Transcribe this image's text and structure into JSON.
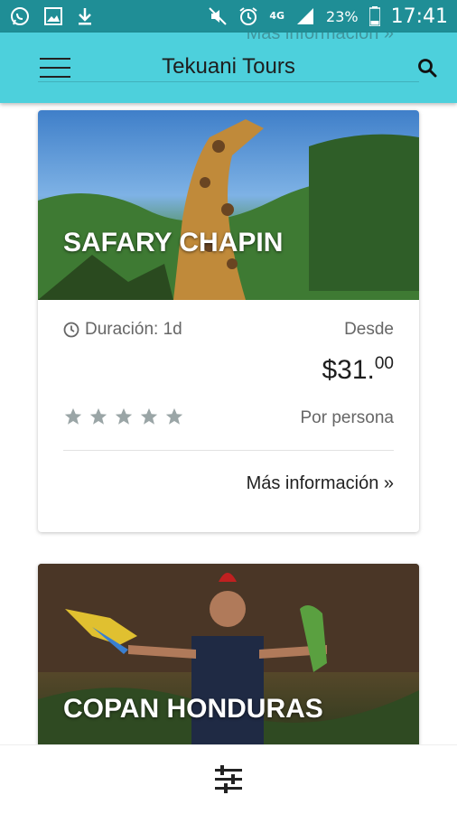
{
  "status_bar": {
    "network_label": "4G",
    "battery": "23%",
    "time": "17:41"
  },
  "app_bar": {
    "title": "Tekuani Tours",
    "ghost_link": "Más información »"
  },
  "tours": [
    {
      "name": "SAFARY CHAPIN",
      "duration_label": "Duración: 1d",
      "from_label": "Desde",
      "price_main": "$31.",
      "price_cents": "00",
      "per_label": "Por persona",
      "rating": 5,
      "more_label": "Más información »"
    },
    {
      "name": "COPAN HONDURAS"
    }
  ],
  "icons": {
    "status_left": [
      "whatsapp-icon",
      "gallery-icon",
      "download-icon"
    ],
    "status_right": [
      "mute-icon",
      "alarm-icon",
      "signal-icon",
      "battery-icon"
    ],
    "menu": "hamburger-menu-icon",
    "search": "search-icon",
    "clock": "clock-icon",
    "star": "star-icon",
    "filter": "filter-sliders-icon"
  },
  "colors": {
    "status_bar": "#1f8e96",
    "app_bar": "#4dd0dc",
    "star": "#9aa5a6"
  }
}
